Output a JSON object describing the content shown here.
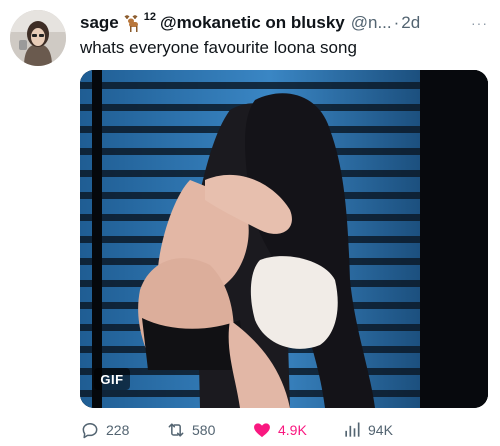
{
  "tweet": {
    "display_name": "sage",
    "name_emoji": "deer-icon",
    "superscript": "12",
    "handle_name": "@mokanetic on blusky",
    "handle": "@n...",
    "separator": "·",
    "timestamp": "2d",
    "more_label": "···",
    "text": "whats everyone favourite loona song"
  },
  "media": {
    "badge": "GIF"
  },
  "actions": {
    "replies": "228",
    "retweets": "580",
    "likes": "4.9K",
    "views": "94K"
  },
  "colors": {
    "text": "#0f1419",
    "secondary": "#536471",
    "like": "#f91880",
    "blinds": "#2d6fa8"
  }
}
